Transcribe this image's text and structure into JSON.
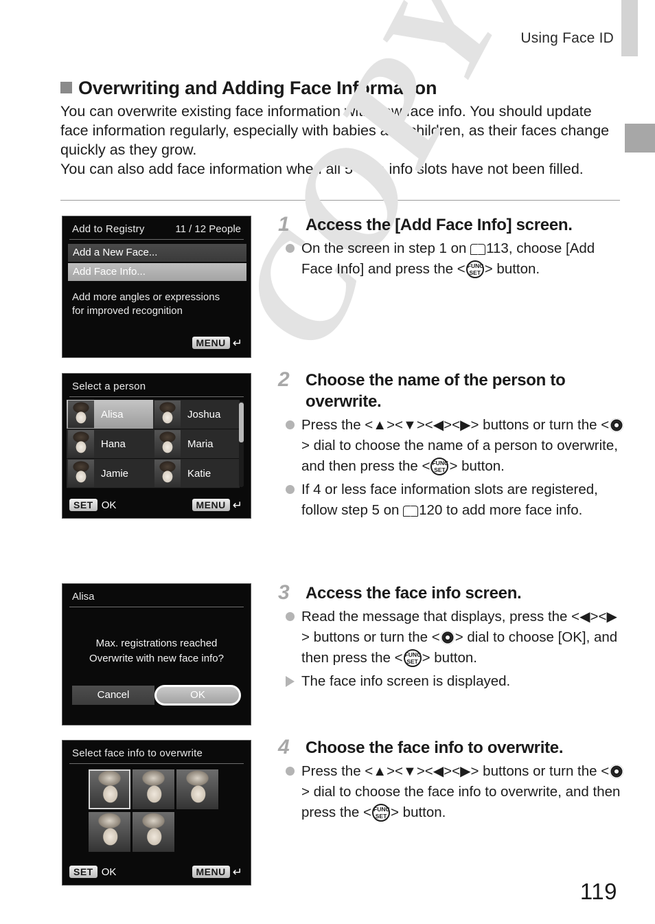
{
  "header": {
    "running_title": "Using Face ID"
  },
  "section": {
    "heading": "Overwriting and Adding Face Information",
    "paragraph1": "You can overwrite existing face information with new face info. You should update face information regularly, especially with babies and children, as their faces change quickly as they grow.",
    "paragraph2": "You can also add face information when all 5 face info slots have not been filled."
  },
  "watermark": {
    "text": "COPY"
  },
  "page_number": "119",
  "colors": {
    "tab_light": "#d3d3d3",
    "tab_dark": "#a7a7a7",
    "heading_square": "#8a8a8a",
    "step_number": "#a8a8a8",
    "bullet": "#b4b4b4",
    "watermark": "#e3e3e3",
    "screen_background": "#0a0a0a",
    "screen_highlight": "#b0b0b0"
  },
  "screens": {
    "add_to_registry": {
      "title": "Add to Registry",
      "count": "11 / 12 People",
      "items": [
        {
          "label": "Add a New Face...",
          "selected": false
        },
        {
          "label": "Add Face Info...",
          "selected": true
        }
      ],
      "description_line1": "Add more angles or expressions",
      "description_line2": "for improved recognition",
      "menu_badge": "MENU"
    },
    "select_person": {
      "title": "Select a person",
      "people": [
        {
          "name": "Alisa",
          "selected": true
        },
        {
          "name": "Joshua",
          "selected": false
        },
        {
          "name": "Hana",
          "selected": false
        },
        {
          "name": "Maria",
          "selected": false
        },
        {
          "name": "Jamie",
          "selected": false
        },
        {
          "name": "Katie",
          "selected": false
        }
      ],
      "set_badge": "SET",
      "set_label": "OK",
      "menu_badge": "MENU"
    },
    "overwrite_confirm": {
      "title": "Alisa",
      "message_line1": "Max. registrations reached",
      "message_line2": "Overwrite with new face info?",
      "cancel_label": "Cancel",
      "ok_label": "OK"
    },
    "select_face_info": {
      "title": "Select face info to overwrite",
      "thumbnail_count": 5,
      "selected_index": 0,
      "set_badge": "SET",
      "set_label": "OK",
      "menu_badge": "MENU"
    }
  },
  "steps": [
    {
      "number": "1",
      "title": "Access the [Add Face Info] screen.",
      "bullets": [
        {
          "marker": "dot",
          "parts": [
            {
              "t": "text",
              "v": "On the screen in step 1 on "
            },
            {
              "t": "icon",
              "v": "book-icon"
            },
            {
              "t": "text",
              "v": "113, choose [Add Face Info] and press the <"
            },
            {
              "t": "icon",
              "v": "func-set-icon"
            },
            {
              "t": "text",
              "v": "> button."
            }
          ],
          "plain": "On the screen in step 1 on 113, choose [Add Face Info] and press the <FUNC SET> button."
        }
      ]
    },
    {
      "number": "2",
      "title": "Choose the name of the person to overwrite.",
      "bullets": [
        {
          "marker": "dot",
          "plain": "Press the <up><down><left><right> buttons or turn the <dial> dial to choose the name of a person to overwrite, and then press the <FUNC SET> button."
        },
        {
          "marker": "dot",
          "plain": "If 4 or less face information slots are registered, follow step 5 on 120 to add more face info."
        }
      ]
    },
    {
      "number": "3",
      "title": "Access the face info screen.",
      "bullets": [
        {
          "marker": "dot",
          "plain": "Read the message that displays, press the <left><right> buttons or turn the <dial> dial to choose [OK], and then press the <FUNC SET> button."
        },
        {
          "marker": "triangle",
          "plain": "The face info screen is displayed."
        }
      ]
    },
    {
      "number": "4",
      "title": "Choose the face info to overwrite.",
      "bullets": [
        {
          "marker": "dot",
          "plain": "Press the <up><down><left><right> buttons or turn the <dial> dial to choose the face info to overwrite, and then press the <FUNC SET> button."
        }
      ]
    }
  ],
  "step_text": {
    "s1_b1_a": "On the screen in step 1 on ",
    "s1_b1_b": "113, choose [Add Face Info] and press the <",
    "s1_b1_c": "> button.",
    "s2_b1_a": "Press the <",
    "s2_b1_b": "><",
    "s2_b1_c": "><",
    "s2_b1_d": "><",
    "s2_b1_e": "> buttons or turn the <",
    "s2_b1_f": "> dial to choose the name of a person to overwrite, and then press the <",
    "s2_b1_g": "> button.",
    "s2_b2_a": "If 4 or less face information slots are registered, follow step 5 on ",
    "s2_b2_b": "120 to add more face info.",
    "s3_b1_a": "Read the message that displays, press the <",
    "s3_b1_b": "><",
    "s3_b1_c": "> buttons or turn the <",
    "s3_b1_d": "> dial to choose [OK], and then press the <",
    "s3_b1_e": "> button.",
    "s3_b2": "The face info screen is displayed.",
    "s4_b1_a": "Press the <",
    "s4_b1_b": "><",
    "s4_b1_c": "><",
    "s4_b1_d": "><",
    "s4_b1_e": "> buttons or turn the <",
    "s4_b1_f": "> dial to choose the face info to overwrite, and then press the <",
    "s4_b1_g": "> button."
  },
  "glyphs": {
    "up": "▲",
    "down": "▼",
    "left": "◀",
    "right": "▶",
    "return_arrow": "↩",
    "func": "FUNC",
    "set": "SET"
  }
}
